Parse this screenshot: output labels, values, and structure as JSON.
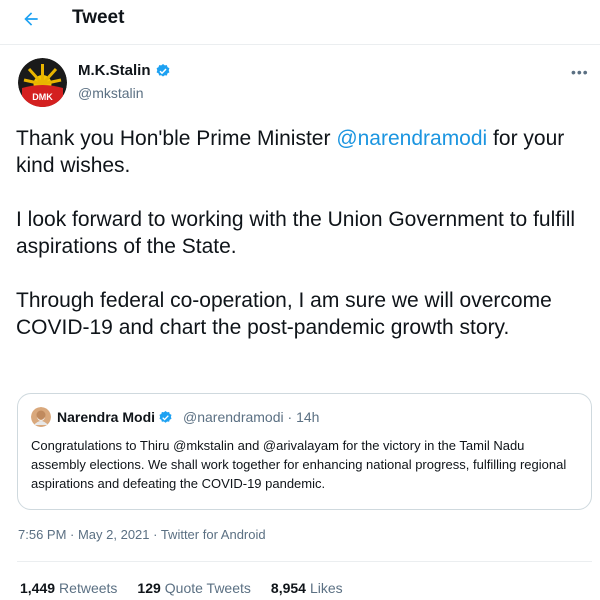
{
  "header": {
    "title": "Tweet",
    "back_icon": "arrow-left-icon"
  },
  "author": {
    "name": "M.K.Stalin",
    "handle": "@mkstalin",
    "avatar_text": "DMK",
    "verified_icon": "verified-badge-icon"
  },
  "tweet": {
    "paragraphs": [
      {
        "before": "Thank you Hon'ble Prime Minister ",
        "mention": "@narendramodi",
        "after": " for your kind wishes."
      },
      {
        "text": "I look forward to working with the Union Government to fulfill aspirations of the State."
      },
      {
        "text": "Through federal co-operation, I am sure we will overcome COVID-19 and chart the post-pandemic growth story."
      }
    ]
  },
  "quote": {
    "name": "Narendra Modi",
    "handle": "@narendramodi",
    "time": "14h",
    "separator": "·",
    "text": "Congratulations to Thiru @mkstalin and @arivalayam for the victory in the Tamil Nadu assembly elections. We shall work together for enhancing national progress, fulfilling regional aspirations and defeating the COVID-19 pandemic."
  },
  "meta": {
    "timestamp": "7:56 PM · May 2, 2021 · Twitter for Android"
  },
  "stats": {
    "retweets_count": "1,449",
    "retweets_label": "Retweets",
    "quotes_count": "129",
    "quotes_label": "Quote Tweets",
    "likes_count": "8,954",
    "likes_label": "Likes"
  },
  "colors": {
    "accent": "#1da1f2",
    "mention": "#1b95e0",
    "secondary_text": "#5b7083",
    "border": "#cfd9de"
  }
}
